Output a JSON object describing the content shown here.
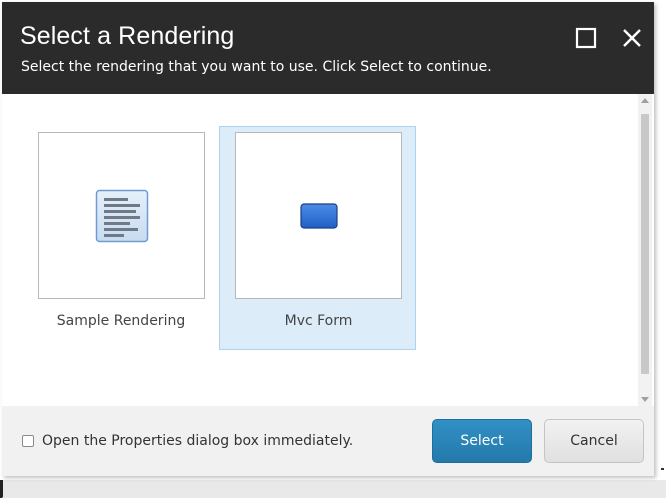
{
  "dialog": {
    "title": "Select a Rendering",
    "subtitle": "Select the rendering that you want to use. Click Select to continue.",
    "controls": {
      "maximize_icon": "maximize-icon",
      "close_icon": "close-icon"
    }
  },
  "renderings": [
    {
      "label": "Sample Rendering",
      "icon": "document-lines-icon",
      "selected": false
    },
    {
      "label": "Mvc Form",
      "icon": "form-rectangle-icon",
      "selected": true
    }
  ],
  "footer": {
    "checkbox_label": "Open the Properties dialog box immediately.",
    "checkbox_checked": false,
    "select_label": "Select",
    "cancel_label": "Cancel"
  },
  "colors": {
    "titlebar_bg": "#2b2b2b",
    "selected_tile_bg": "#dcecf9",
    "select_button_bg": "#2a85b8",
    "footer_bg": "#f1f1f1"
  }
}
